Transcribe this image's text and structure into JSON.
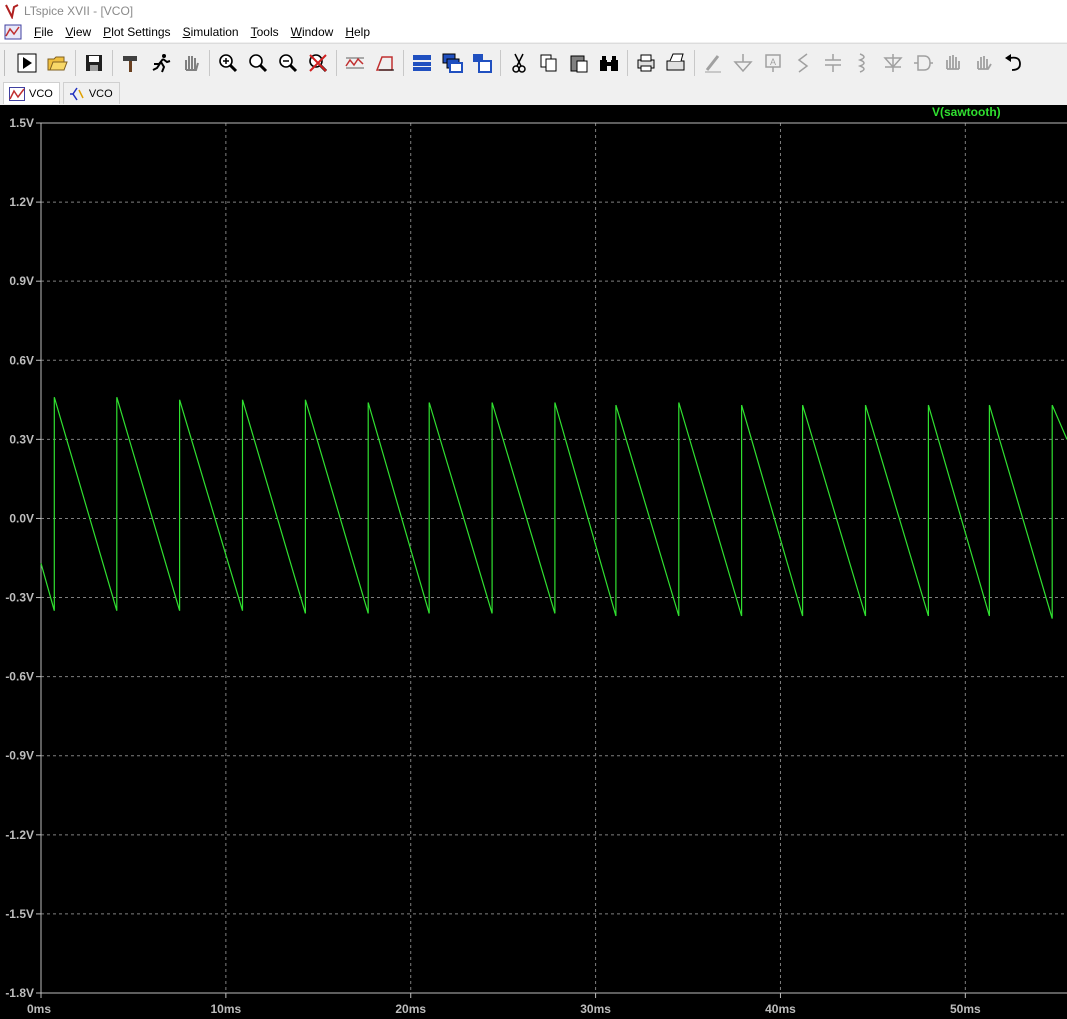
{
  "window": {
    "title": "LTspice XVII - [VCO]"
  },
  "menu": [
    "File",
    "View",
    "Plot Settings",
    "Simulation",
    "Tools",
    "Window",
    "Help"
  ],
  "toolbar": {
    "buttons": [
      "run",
      "open",
      "save",
      "control-panel",
      "halt",
      "pan",
      "zoom-in",
      "zoom-area",
      "zoom-out",
      "zoom-fit",
      "autorange",
      "mark-cursor",
      "tile-horizontal",
      "cascade",
      "tile-vertical",
      "cut",
      "copy",
      "paste",
      "find",
      "print",
      "print-preview",
      "draw-wire",
      "ground",
      "label-net",
      "resistor",
      "capacitor",
      "inductor",
      "diode",
      "component",
      "move",
      "drag",
      "undo"
    ]
  },
  "tabs": [
    {
      "label": "VCO",
      "icon": "waveform-icon",
      "active": true
    },
    {
      "label": "VCO",
      "icon": "schematic-icon",
      "active": false
    }
  ],
  "plot": {
    "trace_name": "V(sawtooth)",
    "trace_color": "#30e030",
    "background": "#000000",
    "grid_color": "#7f7f7f",
    "label_color": "#bdbdbd"
  },
  "chart_data": {
    "type": "line",
    "title": "",
    "xlabel": "",
    "ylabel": "",
    "xlim": [
      0,
      55.5
    ],
    "ylim": [
      -1.8,
      1.5
    ],
    "x_unit": "ms",
    "y_unit": "V",
    "x_ticks": [
      "0ms",
      "10ms",
      "20ms",
      "30ms",
      "40ms",
      "50ms"
    ],
    "y_ticks": [
      "1.5V",
      "1.2V",
      "0.9V",
      "0.6V",
      "0.3V",
      "0.0V",
      "-0.3V",
      "-0.6V",
      "-0.9V",
      "-1.2V",
      "-1.5V",
      "-1.8V"
    ],
    "grid": true,
    "legend": "top-right",
    "series": [
      {
        "name": "V(sawtooth)",
        "color": "#30e030",
        "x": [
          0.0,
          0.72,
          0.72,
          4.1,
          4.1,
          7.5,
          7.5,
          10.9,
          10.9,
          14.3,
          14.3,
          17.7,
          17.7,
          21.0,
          21.0,
          24.4,
          24.4,
          27.8,
          27.8,
          31.1,
          31.1,
          34.5,
          34.5,
          37.9,
          37.9,
          41.2,
          41.2,
          44.6,
          44.6,
          48.0,
          48.0,
          51.3,
          51.3,
          54.7,
          54.7,
          55.5
        ],
        "y": [
          -0.17,
          -0.35,
          0.46,
          -0.35,
          0.46,
          -0.35,
          0.45,
          -0.35,
          0.45,
          -0.36,
          0.45,
          -0.36,
          0.44,
          -0.36,
          0.44,
          -0.36,
          0.44,
          -0.36,
          0.44,
          -0.37,
          0.43,
          -0.37,
          0.44,
          -0.37,
          0.43,
          -0.37,
          0.43,
          -0.37,
          0.43,
          -0.37,
          0.43,
          -0.37,
          0.43,
          -0.38,
          0.43,
          0.3
        ]
      }
    ]
  }
}
